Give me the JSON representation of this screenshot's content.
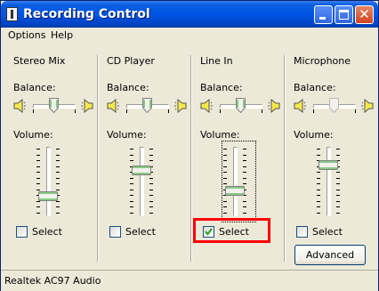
{
  "window": {
    "title": "Recording Control",
    "status": "Realtek AC97 Audio"
  },
  "menu": [
    {
      "label": "Options"
    },
    {
      "label": "Help"
    }
  ],
  "labels": {
    "balance": "Balance:",
    "volume": "Volume:",
    "select": "Select",
    "advanced": "Advanced"
  },
  "channels": [
    {
      "name": "Stereo Mix",
      "balance": 0.5,
      "volume": 0.25,
      "selected": false
    },
    {
      "name": "CD Player",
      "balance": 0.5,
      "volume": 0.7,
      "selected": false
    },
    {
      "name": "Line In",
      "balance": 0.5,
      "volume": 0.35,
      "selected": true
    },
    {
      "name": "Microphone",
      "balance": 0.5,
      "volume": 0.8,
      "selected": false
    }
  ],
  "colors": {
    "title_bar": "#0054e3",
    "slider_thumb_accent": "#21a121",
    "highlight": "#ff0000"
  }
}
